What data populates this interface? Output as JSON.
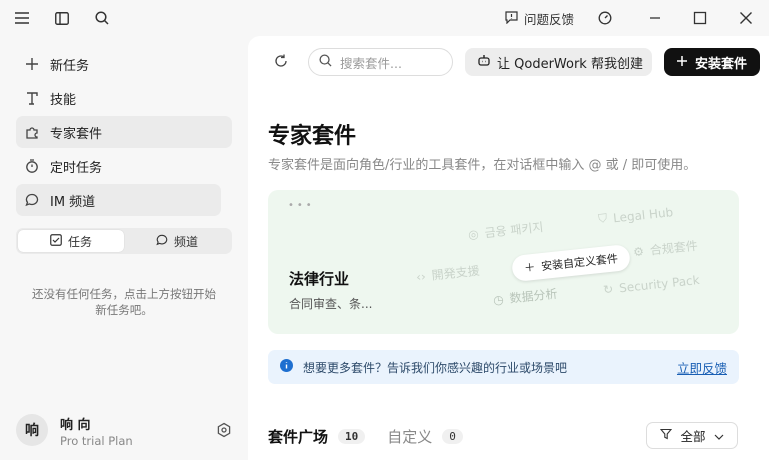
{
  "titlebar": {
    "feedback_label": "问题反馈"
  },
  "sidebar": {
    "items": [
      {
        "label": "新任务",
        "icon": "plus-icon"
      },
      {
        "label": "技能",
        "icon": "skill-icon"
      },
      {
        "label": "专家套件",
        "icon": "puzzle-icon"
      },
      {
        "label": "定时任务",
        "icon": "timer-icon"
      },
      {
        "label": "IM 频道",
        "icon": "chat-icon"
      }
    ],
    "segment": {
      "tasks_label": "任务",
      "channels_label": "频道"
    },
    "empty_text_line1": "还没有任何任务，点击上方按钮开始",
    "empty_text_line2": "新任务吧。",
    "user": {
      "avatar_char": "响",
      "name": "响 向",
      "plan": "Pro trial Plan"
    }
  },
  "main": {
    "search_placeholder": "搜索套件...",
    "qoder_button": "让 QoderWork 帮我创建",
    "install_button": "安装套件",
    "title": "专家套件",
    "subtitle": "专家套件是面向角色/行业的工具套件，在对话框中输入 @ 或 / 即可使用。",
    "card": {
      "title": "法律行业",
      "desc": "合同审查、条...",
      "chip": "安装自定义套件",
      "floaters": [
        "금융 패키지",
        "Legal Hub",
        "合规套件",
        "開発支援",
        "数据分析",
        "Security Pack"
      ]
    },
    "banner": {
      "text": "想要更多套件？告诉我们你感兴趣的行业或场景吧",
      "link": "立即反馈"
    },
    "tabs": [
      {
        "label": "套件广场",
        "count": "10"
      },
      {
        "label": "自定义",
        "count": "0"
      }
    ],
    "filter_label": "全部"
  },
  "colors": {
    "card_bg": "#eef7ef",
    "banner_bg": "#eaf3fd",
    "link": "#1a5fb4",
    "primary_button": "#111111"
  }
}
